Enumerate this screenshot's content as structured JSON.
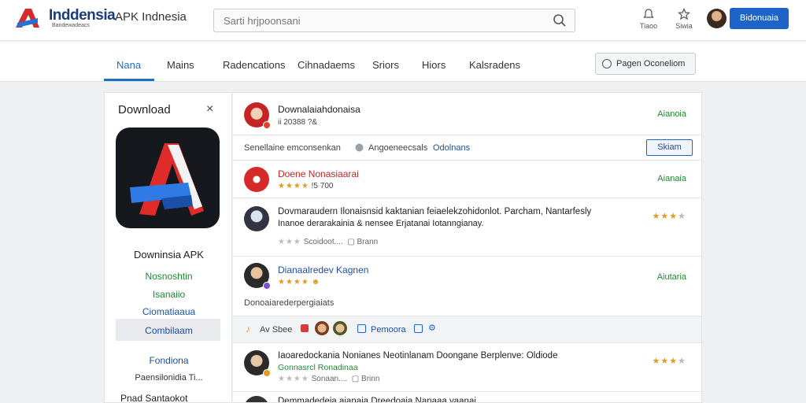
{
  "header": {
    "brand": "Inddensia",
    "brand_sub": "Bandewadeacs",
    "site_title": "APK Indnesia",
    "search_placeholder": "Sarti hrjpoonsani",
    "icons": [
      {
        "name": "bell-icon",
        "label": "Tiaoo"
      },
      {
        "name": "star-icon",
        "label": "Siwia"
      }
    ],
    "cta_label": "Bidonuaia"
  },
  "nav": {
    "tabs": [
      "Nana",
      "Mains",
      "Radencations",
      "Cihnadaems",
      "Sriors",
      "Hiors",
      "Kalsradens"
    ],
    "action_label": "Pagen Oconeliom"
  },
  "left_panel": {
    "title": "Download",
    "close": "×",
    "app_name": "Downinsia APK",
    "links": [
      "Nosnoshtin",
      "Isanaiio",
      "Ciomatiaaua"
    ],
    "active_link": "Combilaam",
    "footer_link": "Fondiona",
    "footer_sub": "Paensilonidia Ti...",
    "footer_note": "Pnad Santaokot"
  },
  "list": {
    "rows": [
      {
        "title": "Downalaiahdonaisa",
        "sub": "ii 20388 ?&",
        "action": "Aianoia"
      },
      {
        "filter_text": "Senellaine emconsenkan",
        "filter_chip": "Angoeneecsals",
        "filter_link": "Odolnans",
        "button": "Skiam"
      },
      {
        "title": "Doene Nonasiaarai",
        "stars_text": "★★★★",
        "sub": "!5 700",
        "action": "Aianaia"
      },
      {
        "title": "Dovmaraudern Ilonaisnsid kaktanian feiaelekzohidonlot. Parcham, Nantarfesly",
        "sub_line2": "Inanoe derarakainia & nensee Erjatanai  Iotanngianay.",
        "meta": "Scoidoot....",
        "meta2": "Brann",
        "stars_text": "★★★"
      },
      {
        "title": "Dianaalredev Kagnen",
        "stars_text": "★★★★",
        "action": "Aiutaria"
      },
      {
        "footer_text": "Donoaiarederpergiaiats"
      },
      {
        "chips": [
          "Av Sbee",
          "Pemoora"
        ]
      },
      {
        "title": "Iaoaredockania Nonianes Neotinlanam Doongane Berplenve: Oldiode",
        "sub": "Gonnasrcl Ronadinaa",
        "meta": "Sonaan....",
        "meta2": "Brinn",
        "stars_text": "★★★"
      },
      {
        "title": "Demmadedeia aianaia  Dreedoaia Nanaaa yaanai"
      }
    ]
  },
  "colors": {
    "accent": "#1e64c8",
    "nav_active": "#1e6fbf",
    "green": "#1e8a2e",
    "star": "#e39a1e"
  }
}
